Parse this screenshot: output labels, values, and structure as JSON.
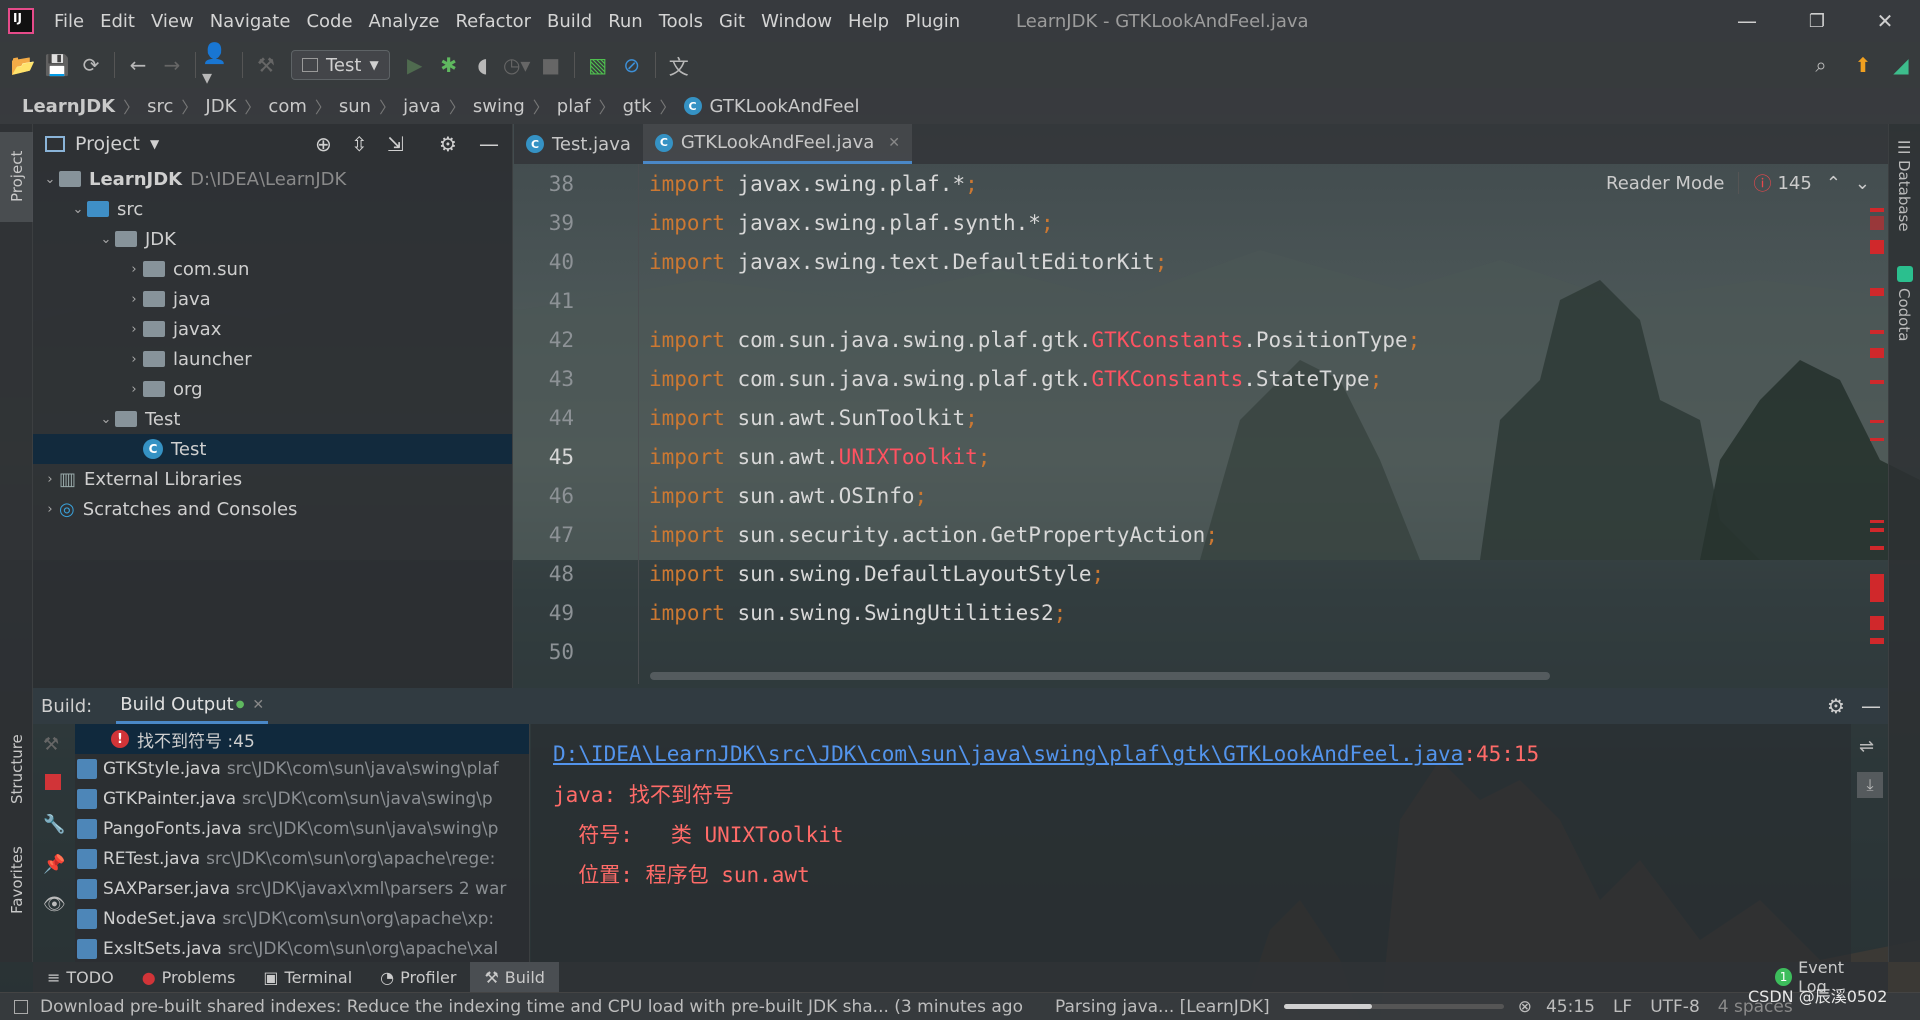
{
  "menubar": {
    "items": [
      "File",
      "Edit",
      "View",
      "Navigate",
      "Code",
      "Analyze",
      "Refactor",
      "Build",
      "Run",
      "Tools",
      "Git",
      "Window",
      "Help",
      "Plugin"
    ],
    "title": "LearnJDK - GTKLookAndFeel.java",
    "minimize": "—",
    "restore": "❐",
    "close": "✕"
  },
  "toolbar": {
    "run_config": "Test"
  },
  "breadcrumbs": [
    "LearnJDK",
    "src",
    "JDK",
    "com",
    "sun",
    "java",
    "swing",
    "plaf",
    "gtk",
    "GTKLookAndFeel"
  ],
  "left_strip": {
    "project_tab": "Project",
    "structure_tab": "Structure",
    "favorites_tab": "Favorites"
  },
  "project_panel": {
    "title": "Project",
    "tree": [
      {
        "label": "LearnJDK",
        "hint": "D:\\IDEA\\LearnJDK",
        "indent": 0,
        "arrow": "⌄",
        "icon": "module"
      },
      {
        "label": "src",
        "indent": 1,
        "arrow": "⌄",
        "icon": "folder-blue"
      },
      {
        "label": "JDK",
        "indent": 2,
        "arrow": "⌄",
        "icon": "folder"
      },
      {
        "label": "com.sun",
        "indent": 3,
        "arrow": "›",
        "icon": "package"
      },
      {
        "label": "java",
        "indent": 3,
        "arrow": "›",
        "icon": "package"
      },
      {
        "label": "javax",
        "indent": 3,
        "arrow": "›",
        "icon": "package"
      },
      {
        "label": "launcher",
        "indent": 3,
        "arrow": "›",
        "icon": "package"
      },
      {
        "label": "org",
        "indent": 3,
        "arrow": "›",
        "icon": "package"
      },
      {
        "label": "Test",
        "indent": 2,
        "arrow": "⌄",
        "icon": "folder"
      },
      {
        "label": "Test",
        "indent": 3,
        "arrow": "",
        "icon": "class",
        "selected": true
      },
      {
        "label": "External Libraries",
        "indent": 0,
        "arrow": "›",
        "icon": "libraries"
      },
      {
        "label": "Scratches and Consoles",
        "indent": 0,
        "arrow": "›",
        "icon": "scratches"
      }
    ]
  },
  "editor": {
    "tabs": [
      {
        "label": "Test.java",
        "active": false
      },
      {
        "label": "GTKLookAndFeel.java",
        "active": true
      }
    ],
    "reader_mode": "Reader Mode",
    "error_count": "145",
    "lines": [
      {
        "n": "38",
        "segments": [
          [
            "kw",
            "import "
          ],
          [
            "txt",
            "javax.swing.plaf.*"
          ],
          [
            "punc",
            ";"
          ]
        ]
      },
      {
        "n": "39",
        "segments": [
          [
            "kw",
            "import "
          ],
          [
            "txt",
            "javax.swing.plaf.synth.*"
          ],
          [
            "punc",
            ";"
          ]
        ]
      },
      {
        "n": "40",
        "segments": [
          [
            "kw",
            "import "
          ],
          [
            "txt",
            "javax.swing.text.DefaultEditorKit"
          ],
          [
            "punc",
            ";"
          ]
        ]
      },
      {
        "n": "41",
        "segments": []
      },
      {
        "n": "42",
        "segments": [
          [
            "kw",
            "import "
          ],
          [
            "txt",
            "com.sun.java.swing.plaf.gtk."
          ],
          [
            "err",
            "GTKConstants"
          ],
          [
            "txt",
            ".PositionType"
          ],
          [
            "punc",
            ";"
          ]
        ]
      },
      {
        "n": "43",
        "segments": [
          [
            "kw",
            "import "
          ],
          [
            "txt",
            "com.sun.java.swing.plaf.gtk."
          ],
          [
            "err",
            "GTKConstants"
          ],
          [
            "txt",
            ".StateType"
          ],
          [
            "punc",
            ";"
          ]
        ]
      },
      {
        "n": "44",
        "segments": [
          [
            "kw",
            "import "
          ],
          [
            "txt",
            "sun.awt.SunToolkit"
          ],
          [
            "punc",
            ";"
          ]
        ]
      },
      {
        "n": "45",
        "segments": [
          [
            "kw",
            "import "
          ],
          [
            "txt",
            "sun.awt."
          ],
          [
            "err",
            "UNIXToolkit"
          ],
          [
            "punc",
            ";"
          ]
        ]
      },
      {
        "n": "46",
        "segments": [
          [
            "kw",
            "import "
          ],
          [
            "txt",
            "sun.awt.OSInfo"
          ],
          [
            "punc",
            ";"
          ]
        ]
      },
      {
        "n": "47",
        "segments": [
          [
            "kw",
            "import "
          ],
          [
            "txt",
            "sun.security.action.GetPropertyAction"
          ],
          [
            "punc",
            ";"
          ]
        ]
      },
      {
        "n": "48",
        "segments": [
          [
            "kw",
            "import "
          ],
          [
            "txt",
            "sun.swing.DefaultLayoutStyle"
          ],
          [
            "punc",
            ";"
          ]
        ]
      },
      {
        "n": "49",
        "segments": [
          [
            "kw",
            "import "
          ],
          [
            "txt",
            "sun.swing.SwingUtilities2"
          ],
          [
            "punc",
            ";"
          ]
        ]
      },
      {
        "n": "50",
        "segments": []
      }
    ],
    "current_line": "45"
  },
  "right_strip": {
    "database_tab": "Database",
    "codota_tab": "Codota"
  },
  "build": {
    "label": "Build:",
    "tab": "Build Output",
    "selected_error": "找不到符号 :45",
    "files": [
      {
        "name": "GTKStyle.java",
        "path": "src\\JDK\\com\\sun\\java\\swing\\plaf"
      },
      {
        "name": "GTKPainter.java",
        "path": "src\\JDK\\com\\sun\\java\\swing\\p"
      },
      {
        "name": "PangoFonts.java",
        "path": "src\\JDK\\com\\sun\\java\\swing\\p"
      },
      {
        "name": "RETest.java",
        "path": "src\\JDK\\com\\sun\\org\\apache\\rege:"
      },
      {
        "name": "SAXParser.java",
        "path": "src\\JDK\\javax\\xml\\parsers 2 war"
      },
      {
        "name": "NodeSet.java",
        "path": "src\\JDK\\com\\sun\\org\\apache\\xp:"
      },
      {
        "name": "ExsltSets.java",
        "path": "src\\JDK\\com\\sun\\org\\apache\\xal"
      }
    ],
    "output": {
      "link": "D:\\IDEA\\LearnJDK\\src\\JDK\\com\\sun\\java\\swing\\plaf\\gtk\\GTKLookAndFeel.java",
      "position": ":45:15",
      "line2": "java: 找不到符号",
      "line3": "  符号:   类 UNIXToolkit",
      "line4": "  位置: 程序包 sun.awt"
    }
  },
  "bottom_tabs": [
    {
      "label": "TODO",
      "icon": "≡"
    },
    {
      "label": "Problems",
      "icon": "●"
    },
    {
      "label": "Terminal",
      "icon": "▣"
    },
    {
      "label": "Profiler",
      "icon": "◔"
    },
    {
      "label": "Build",
      "icon": "⚒",
      "active": true
    }
  ],
  "event_log": "Event Log",
  "event_log_count": "1",
  "status": {
    "message": "Download pre-built shared indexes: Reduce the indexing time and CPU load with pre-built JDK sha... (3 minutes ago",
    "task": "Parsing java... [LearnJDK]",
    "progress": 0.4,
    "position": "45:15",
    "line_sep": "LF",
    "encoding": "UTF-8",
    "indent": "4 spaces",
    "watermark": "CSDN @辰溪0502"
  },
  "colors": {
    "keyword": "#cc7832",
    "error": "#ff5261",
    "link": "#5394ec",
    "selection": "#0d293e",
    "accent": "#4a88c7"
  }
}
